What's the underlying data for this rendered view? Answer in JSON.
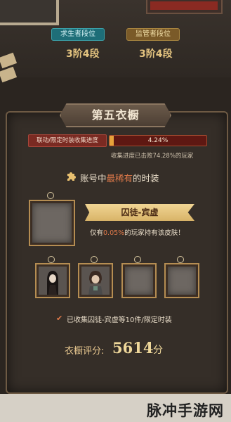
{
  "ranks": {
    "survivor_label": "求生者段位",
    "survivor_value": "3阶4段",
    "hunter_label": "监管者段位",
    "hunter_value": "3阶4段"
  },
  "wardrobe": {
    "title": "第五衣橱",
    "progress_label": "联动/限定时装收集进度",
    "progress_percent": 4.24,
    "progress_text": "4.24%",
    "progress_note": "收集进度已击败74.28%的玩家"
  },
  "rarest": {
    "title_prefix": "账号中",
    "title_highlight": "最稀有",
    "title_suffix": "的时装",
    "item_name": "囚徒-宾虚",
    "note_prefix": "仅有",
    "note_highlight": "0.05%",
    "note_suffix": "的玩家持有该皮肤！"
  },
  "collected_note": "已收集囚徒-宾虚等10件/限定时装",
  "score": {
    "label": "衣橱评分:",
    "value": "5614",
    "unit": "分"
  },
  "watermark": "脉冲手游网",
  "colors": {
    "accent": "#e07a4a",
    "gold": "#eed79a",
    "progress_fill": "#e8a23a"
  }
}
